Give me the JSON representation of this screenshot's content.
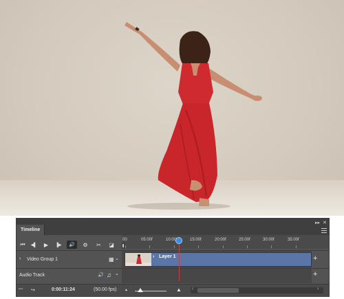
{
  "panel": {
    "tab_label": "Timeline",
    "collapse_glyph": "▸▸",
    "close_glyph": "✕"
  },
  "transport": {
    "first_frame_icon": "⏮",
    "prev_frame_icon": "◀▌",
    "play_icon": "▶",
    "next_frame_icon": "▐▶",
    "audio_icon": "🔊",
    "settings_icon": "⚙",
    "split_icon": "✂",
    "transition_icon": "◪"
  },
  "ruler": {
    "labels": [
      "00",
      "05:00f",
      "10:00f",
      "15:00f",
      "20:00f",
      "25:00f",
      "30:00f",
      "35:00f"
    ]
  },
  "tracks": {
    "video_group_label": "Video Group 1",
    "video_group_chevron": "›",
    "film_icon": "▦",
    "layer_name": "Layer 1",
    "layer_chevron": "›",
    "add_glyph": "+",
    "audio_track_label": "Audio Track",
    "speaker_icon": "🔊",
    "music_icon": "♫",
    "dropdown_glyph": "⌄"
  },
  "footer": {
    "render_icon": "▫▫▫",
    "convert_icon": "↪",
    "timecode": "0:00:11:24",
    "fps": "(50.00 fps)",
    "zoom_out_icon": "▲",
    "zoom_in_icon": "▲",
    "scroll_left": "‹",
    "scroll_right": "›"
  },
  "colors": {
    "dress": "#cf2a2f",
    "clip": "#5b76a6",
    "playhead": "#3d8ee6",
    "playline": "#d43a3a",
    "panel_bg": "#535353"
  }
}
